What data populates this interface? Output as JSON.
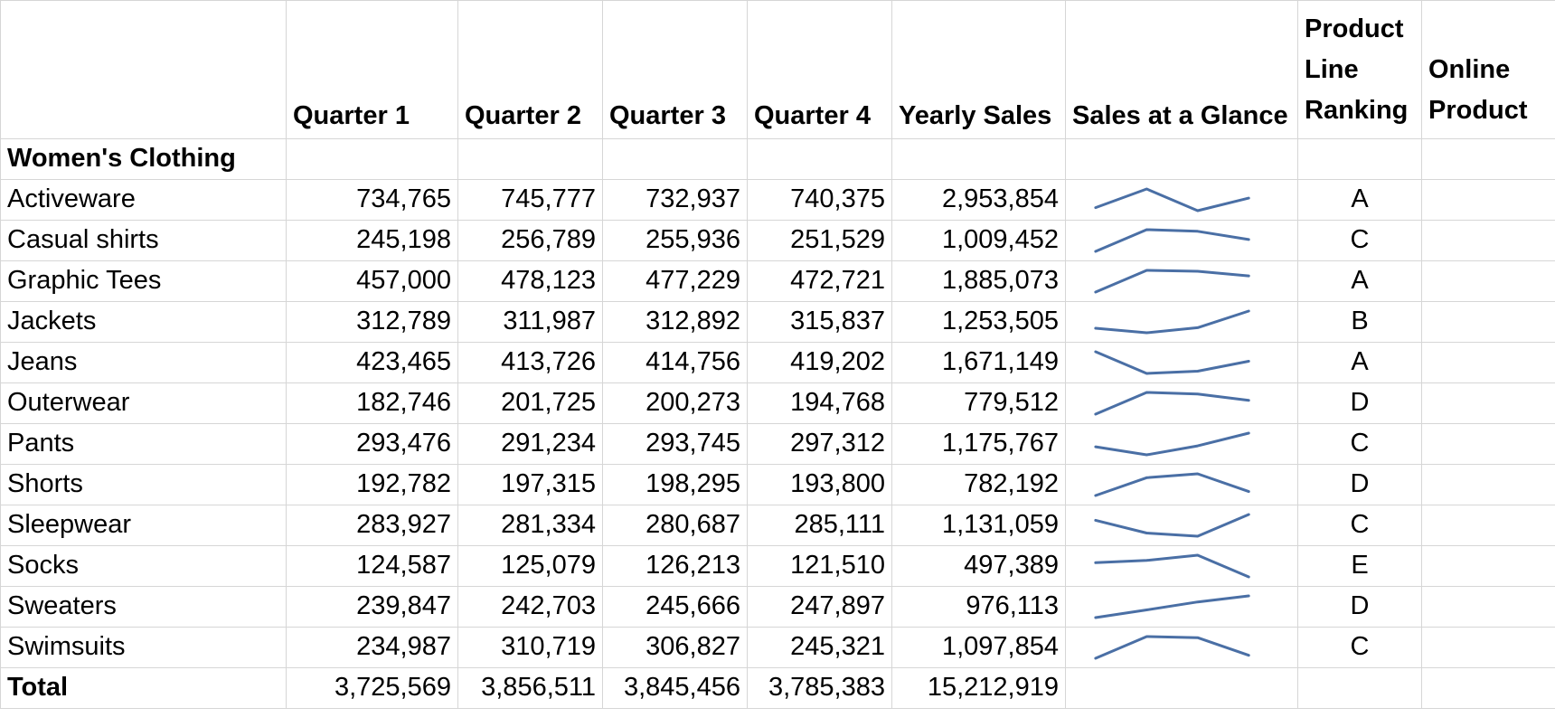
{
  "headers": {
    "category": "",
    "q1": "Quarter 1",
    "q2": "Quarter 2",
    "q3": "Quarter 3",
    "q4": "Quarter 4",
    "yearly": "Yearly Sales",
    "glance": "Sales at a Glance",
    "ranking": "Product Line Ranking",
    "online": "Online Product"
  },
  "section_label": "Women's Clothing",
  "rows": [
    {
      "name": "Activeware",
      "q": [
        734765,
        745777,
        732937,
        740375
      ],
      "q1": "734,765",
      "q2": "745,777",
      "q3": "732,937",
      "q4": "740,375",
      "yearly": "2,953,854",
      "rank": "A",
      "online": ""
    },
    {
      "name": "Casual shirts",
      "q": [
        245198,
        256789,
        255936,
        251529
      ],
      "q1": "245,198",
      "q2": "256,789",
      "q3": "255,936",
      "q4": "251,529",
      "yearly": "1,009,452",
      "rank": "C",
      "online": ""
    },
    {
      "name": "Graphic Tees",
      "q": [
        457000,
        478123,
        477229,
        472721
      ],
      "q1": "457,000",
      "q2": "478,123",
      "q3": "477,229",
      "q4": "472,721",
      "yearly": "1,885,073",
      "rank": "A",
      "online": ""
    },
    {
      "name": "Jackets",
      "q": [
        312789,
        311987,
        312892,
        315837
      ],
      "q1": "312,789",
      "q2": "311,987",
      "q3": "312,892",
      "q4": "315,837",
      "yearly": "1,253,505",
      "rank": "B",
      "online": ""
    },
    {
      "name": "Jeans",
      "q": [
        423465,
        413726,
        414756,
        419202
      ],
      "q1": "423,465",
      "q2": "413,726",
      "q3": "414,756",
      "q4": "419,202",
      "yearly": "1,671,149",
      "rank": "A",
      "online": ""
    },
    {
      "name": "Outerwear",
      "q": [
        182746,
        201725,
        200273,
        194768
      ],
      "q1": "182,746",
      "q2": "201,725",
      "q3": "200,273",
      "q4": "194,768",
      "yearly": "779,512",
      "rank": "D",
      "online": ""
    },
    {
      "name": "Pants",
      "q": [
        293476,
        291234,
        293745,
        297312
      ],
      "q1": "293,476",
      "q2": "291,234",
      "q3": "293,745",
      "q4": "297,312",
      "yearly": "1,175,767",
      "rank": "C",
      "online": ""
    },
    {
      "name": "Shorts",
      "q": [
        192782,
        197315,
        198295,
        193800
      ],
      "q1": "192,782",
      "q2": "197,315",
      "q3": "198,295",
      "q4": "193,800",
      "yearly": "782,192",
      "rank": "D",
      "online": ""
    },
    {
      "name": "Sleepwear",
      "q": [
        283927,
        281334,
        280687,
        285111
      ],
      "q1": "283,927",
      "q2": "281,334",
      "q3": "280,687",
      "q4": "285,111",
      "yearly": "1,131,059",
      "rank": "C",
      "online": ""
    },
    {
      "name": "Socks",
      "q": [
        124587,
        125079,
        126213,
        121510
      ],
      "q1": "124,587",
      "q2": "125,079",
      "q3": "126,213",
      "q4": "121,510",
      "yearly": "497,389",
      "rank": "E",
      "online": ""
    },
    {
      "name": "Sweaters",
      "q": [
        239847,
        242703,
        245666,
        247897
      ],
      "q1": "239,847",
      "q2": "242,703",
      "q3": "245,666",
      "q4": "247,897",
      "yearly": "976,113",
      "rank": "D",
      "online": ""
    },
    {
      "name": "Swimsuits",
      "q": [
        234987,
        310719,
        306827,
        245321
      ],
      "q1": "234,987",
      "q2": "310,719",
      "q3": "306,827",
      "q4": "245,321",
      "yearly": "1,097,854",
      "rank": "C",
      "online": ""
    }
  ],
  "total": {
    "label": "Total",
    "q1": "3,725,569",
    "q2": "3,856,511",
    "q3": "3,845,456",
    "q4": "3,785,383",
    "yearly": "15,212,919"
  },
  "colors": {
    "sparkline": "#4a6fa5",
    "gridline": "#d6d6d6"
  }
}
